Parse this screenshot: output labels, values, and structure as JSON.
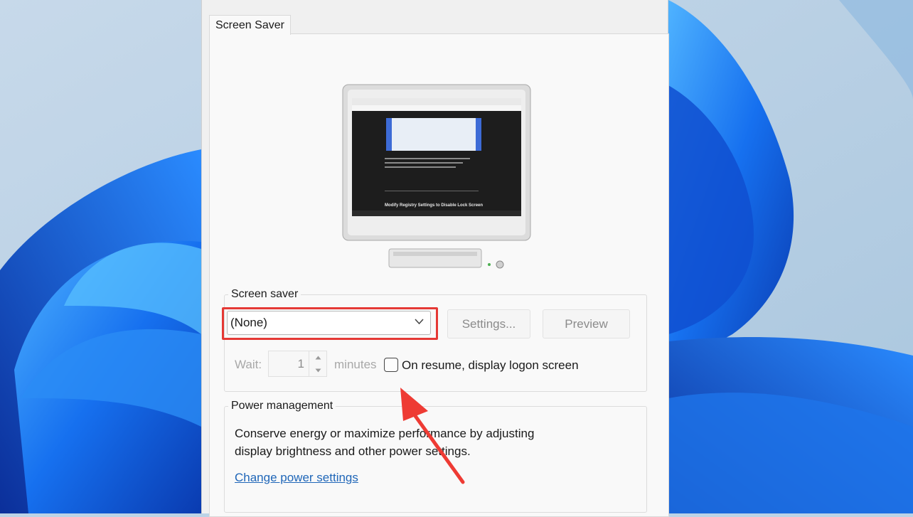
{
  "tab": {
    "label": "Screen Saver"
  },
  "preview": {
    "heading": "Modify Registry Settings to Disable Lock Screen"
  },
  "screen_saver": {
    "group_label": "Screen saver",
    "selected": "(None)",
    "settings_label": "Settings...",
    "preview_label": "Preview",
    "wait_label": "Wait:",
    "wait_value": "1",
    "minutes_label": "minutes",
    "resume_label": "On resume, display logon screen",
    "resume_checked": false
  },
  "power": {
    "group_label": "Power management",
    "description_line1": "Conserve energy or maximize performance by adjusting",
    "description_line2": "display brightness and other power settings.",
    "link_label": "Change power settings"
  },
  "colors": {
    "highlight": "#e53935",
    "link": "#1f66b8",
    "wallpaper_blue": "#1565e0"
  }
}
